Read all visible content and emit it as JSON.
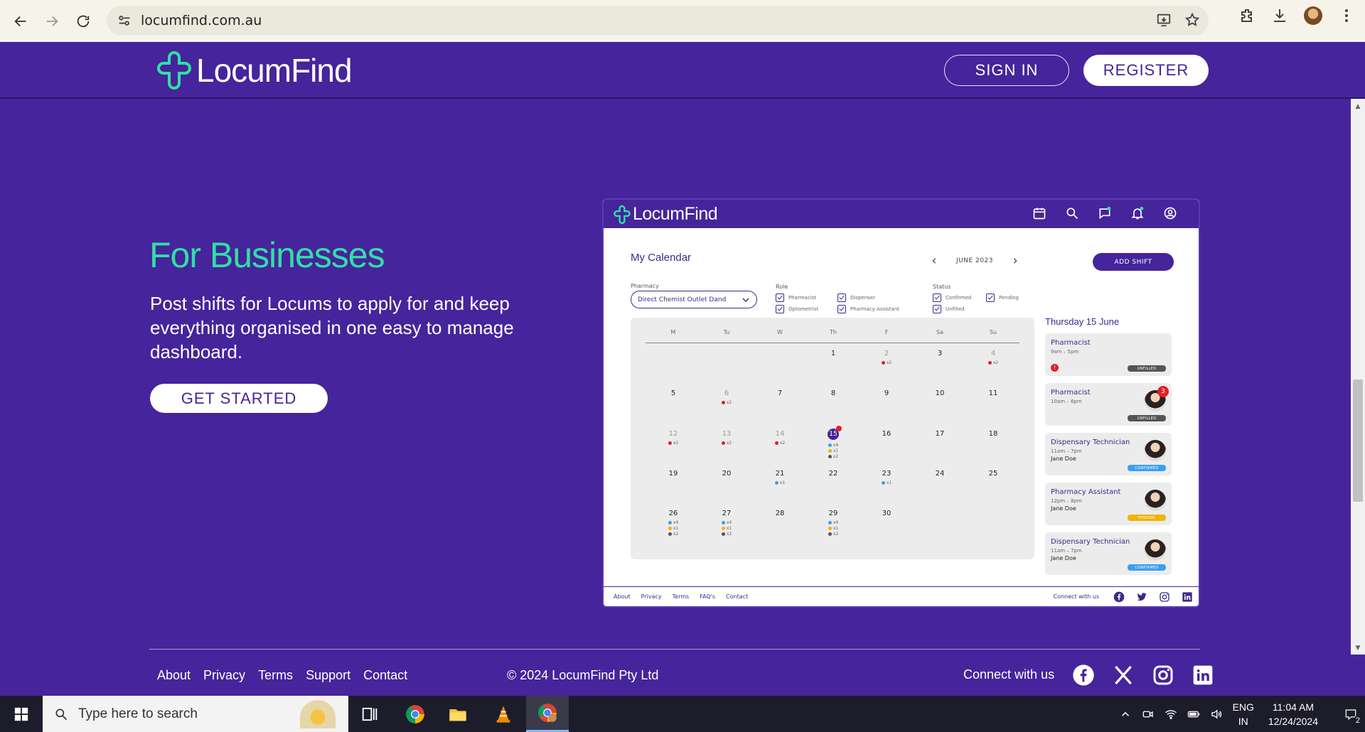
{
  "browser": {
    "url": "locumfind.com.au"
  },
  "header": {
    "logo_text": "LocumFind",
    "signin_label": "SIGN IN",
    "register_label": "REGISTER"
  },
  "hero": {
    "title": "For Businesses",
    "description": "Post shifts for Locums to apply for and keep everything organised in one easy to manage dashboard.",
    "cta_label": "GET STARTED"
  },
  "dashboard": {
    "logo_text": "LocumFind",
    "title": "My Calendar",
    "month": "JUNE 2023",
    "add_shift_label": "ADD SHIFT",
    "pharmacy_label": "Pharmacy",
    "pharmacy_value": "Direct Chemist Outlet Dand",
    "role_label": "Role",
    "roles": [
      "Pharmacist",
      "Dispenser",
      "Optometrist",
      "Pharmacy Assistant"
    ],
    "status_label": "Status",
    "statuses": [
      "Confirmed",
      "Pending",
      "Unfilled"
    ],
    "weekdays": [
      "M",
      "Tu",
      "W",
      "Th",
      "F",
      "Sa",
      "Su"
    ],
    "side_title": "Thursday 15 June",
    "shifts": [
      {
        "role": "Pharmacist",
        "time": "9am – 5pm",
        "person": "",
        "status": "UNFILLED"
      },
      {
        "role": "Pharmacist",
        "time": "10am – 6pm",
        "person": "",
        "status": "UNFILLED",
        "count": "3"
      },
      {
        "role": "Dispensary Technician",
        "time": "11am – 7pm",
        "person": "Jane Doe",
        "status": "CONFIRMED"
      },
      {
        "role": "Pharmacy Assistant",
        "time": "12pm – 8pm",
        "person": "Jane Doe",
        "status": "PENDING"
      },
      {
        "role": "Dispensary Technician",
        "time": "11am – 7pm",
        "person": "Jane Doe",
        "status": "CONFIRMED"
      }
    ],
    "footer_links": [
      "About",
      "Privacy",
      "Terms",
      "FAQ's",
      "Contact"
    ],
    "connect_label": "Connect with us",
    "colors": {
      "unfilled": "#555555",
      "confirmed": "#3aa0f0",
      "pending": "#f0b400",
      "alert": "#e0202a"
    }
  },
  "footer": {
    "links": [
      "About",
      "Privacy",
      "Terms",
      "Support",
      "Contact"
    ],
    "copyright": "© 2024 LocumFind Pty Ltd",
    "connect_label": "Connect with us"
  },
  "taskbar": {
    "search_placeholder": "Type here to search",
    "lang_line1": "ENG",
    "lang_line2": "IN",
    "time": "11:04 AM",
    "date": "12/24/2024",
    "notification_count": "2"
  },
  "colors": {
    "brand_purple": "#46249b",
    "accent_green": "#2fe0a4"
  }
}
